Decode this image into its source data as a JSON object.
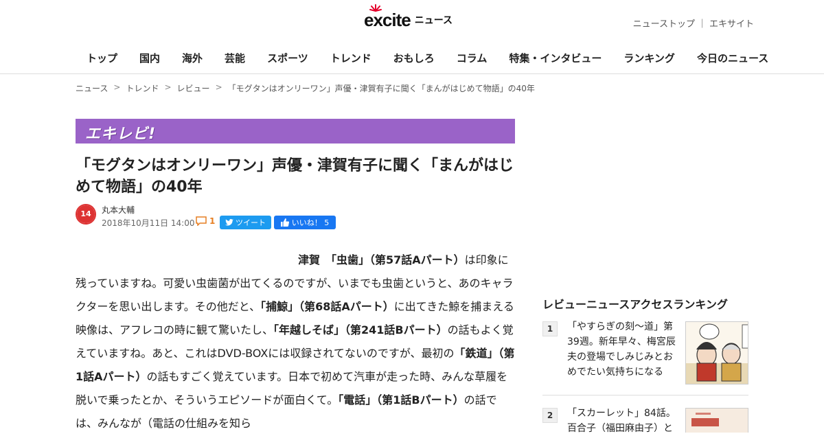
{
  "header": {
    "logo_text": "excite",
    "logo_sub": "ニュース",
    "top_links": [
      "ニューストップ",
      "｜",
      "エキサイト"
    ]
  },
  "nav": [
    "トップ",
    "国内",
    "海外",
    "芸能",
    "スポーツ",
    "トレンド",
    "おもしろ",
    "コラム",
    "特集・インタビュー",
    "ランキング",
    "今日のニュース"
  ],
  "breadcrumb": [
    "ニュース",
    "トレンド",
    "レビュー",
    "「モグタンはオンリーワン」声優・津賀有子に聞く「まんがはじめて物語」の40年"
  ],
  "breadcrumb_sep": ">",
  "banner": "エキレビ!",
  "article": {
    "title": "「モグタンはオンリーワン」声優・津賀有子に聞く「まんがはじめて物語」の40年",
    "author": "丸本大輔",
    "date": "2018年10月11日 14:00",
    "avatar_label": "14",
    "comment_count": "1",
    "tweet_label": "ツイート",
    "like_label": "いいね！ 5",
    "seg": [
      "津賀　",
      "「虫歯」（第57話Aパート）",
      "は印象に残っていますね。可愛い虫歯菌が出てくるのですが、いまでも虫歯というと、あのキャラクターを思い出します。その他だと、",
      "「捕鯨」（第68話Aパート）",
      "に出てきた鯨を捕まえる映像は、アフレコの時に観て驚いたし、",
      "「年越しそば」（第241話Bパート）",
      "の話もよく覚えていますね。あと、これはDVD-BOXには収録されてないのですが、最初の",
      "「鉄道」（第1話Aパート）",
      "の話もすごく覚えています。日本で初めて汽車が走った時、みんな草履を脱いで乗ったとか、そういうエピソードが面白くて。",
      "「電話」（第1話Bパート）",
      "の話では、みんなが（電話の仕組みを知ら"
    ]
  },
  "sidebar": {
    "ranking_title": "レビューニュースアクセスランキング",
    "items": [
      {
        "rank": "1",
        "text": "「やすらぎの刻～道」第39週。新年早々、梅宮辰夫の登場でしみじみとおめでたい気持ちになる"
      },
      {
        "rank": "2",
        "text": "「スカーレット」84話。百合子（福田麻由子）と"
      }
    ]
  },
  "colors": {
    "banner": "#9a63c8",
    "twitter": "#1d9bf0",
    "facebook": "#1877f2",
    "comment": "#e67e22",
    "logo_accent": "#e4002b"
  },
  "icons": [
    "logo-spark-icon",
    "comment-icon",
    "twitter-bird-icon",
    "thumbs-up-icon"
  ]
}
